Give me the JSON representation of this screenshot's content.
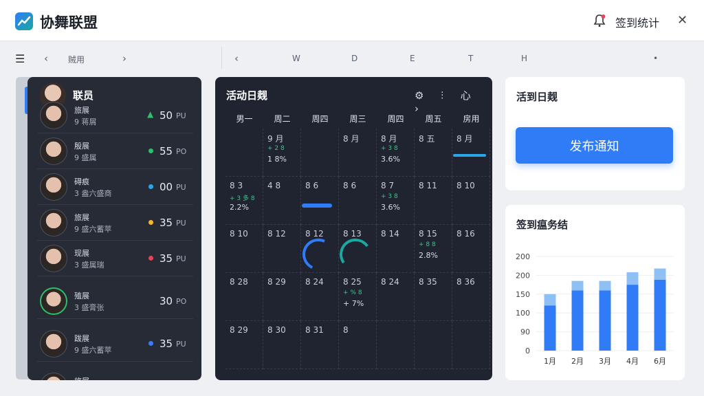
{
  "app": {
    "title": "协舞联盟",
    "stat_link": "签到统计"
  },
  "subbar": {
    "left_label": "贼用",
    "week_letters": [
      "W",
      "D",
      "E",
      "T",
      "H",
      "•"
    ]
  },
  "members": {
    "title": "联员",
    "rows": [
      {
        "name": "旅展",
        "sub": "9 蒋屑",
        "value": "50",
        "unit": "PU",
        "color": "#2fbf6a",
        "indicator": "arrow-up"
      },
      {
        "name": "殷展",
        "sub": "9 盛属",
        "value": "55",
        "unit": "PO",
        "color": "#2fbf6a",
        "indicator": "dot"
      },
      {
        "name": "碍痕",
        "sub": "3 盎六盛商",
        "value": "00",
        "unit": "PU",
        "color": "#2aa7e6",
        "indicator": "dot"
      },
      {
        "name": "旅展",
        "sub": "9 盛六蓄苹",
        "value": "35",
        "unit": "PU",
        "color": "#f2b632",
        "indicator": "dot"
      },
      {
        "name": "现展",
        "sub": "3 盛属瑞",
        "value": "35",
        "unit": "PU",
        "color": "#e5445a",
        "indicator": "dot"
      },
      {
        "name": "殖展",
        "sub": "3 盛膏张",
        "value": "30",
        "unit": "PO",
        "color": "#2fbf6a",
        "indicator": "ring"
      },
      {
        "name": "跋展",
        "sub": "9 盛六蓄苹",
        "value": "35",
        "unit": "PU",
        "color": "#3e7bf0",
        "indicator": "dot"
      },
      {
        "name": "旅展",
        "sub": "",
        "value": "",
        "unit": "",
        "color": "#2fbf6a",
        "indicator": "none"
      }
    ]
  },
  "calendar": {
    "title": "活动日觌",
    "icons": [
      "gear-icon",
      "tune-icon",
      "heart-icon",
      "chevron-right-icon"
    ],
    "icon_glyphs": "⚙ ⫶ 心 ›",
    "weekdays": [
      "男一",
      "周二",
      "周四",
      "周三",
      "周四",
      "周五",
      "房用"
    ],
    "rows": [
      [
        {
          "d": "",
          "e1": "",
          "e2": ""
        },
        {
          "d": "9 月",
          "e1": "+ 2 8 ",
          "e2": "1 8%"
        },
        {
          "d": "",
          "e1": "",
          "e2": ""
        },
        {
          "d": "8 月",
          "e1": "",
          "e2": ""
        },
        {
          "d": "8 月",
          "e1": "+ 3 8 ",
          "e2": "3.6%"
        },
        {
          "d": "8 五",
          "e1": "",
          "e2": ""
        },
        {
          "d": "8 月",
          "e1": "",
          "e2": ""
        }
      ],
      [
        {
          "d": "8 3",
          "e1": "+ 3 多 8",
          "e2": "2.2%"
        },
        {
          "d": "4 8",
          "e1": "",
          "e2": ""
        },
        {
          "d": "8 6",
          "e1": "",
          "e2": ""
        },
        {
          "d": "8 6",
          "e1": "",
          "e2": ""
        },
        {
          "d": "8 7",
          "e1": "+ 3 8 ",
          "e2": "3.6%"
        },
        {
          "d": "8 11",
          "e1": "",
          "e2": ""
        },
        {
          "d": "8 10",
          "e1": "",
          "e2": ""
        }
      ],
      [
        {
          "d": "8 10",
          "e1": "",
          "e2": ""
        },
        {
          "d": "8 12",
          "e1": "",
          "e2": ""
        },
        {
          "d": "8 12",
          "e1": "",
          "e2": ""
        },
        {
          "d": "8 13",
          "e1": "",
          "e2": ""
        },
        {
          "d": "8 14",
          "e1": "",
          "e2": ""
        },
        {
          "d": "8 15",
          "e1": "+ 8 8 ",
          "e2": "2.8%"
        },
        {
          "d": "8 16",
          "e1": "",
          "e2": ""
        }
      ],
      [
        {
          "d": "8 28",
          "e1": "",
          "e2": ""
        },
        {
          "d": "8 29",
          "e1": "",
          "e2": ""
        },
        {
          "d": "8 24",
          "e1": "",
          "e2": ""
        },
        {
          "d": "8 25",
          "e1": "+ % 8 ",
          "e2": "+ 7%"
        },
        {
          "d": "8 24",
          "e1": "",
          "e2": ""
        },
        {
          "d": "8 35",
          "e1": "",
          "e2": ""
        },
        {
          "d": "8 36",
          "e1": "",
          "e2": ""
        }
      ],
      [
        {
          "d": "8 29",
          "e1": "",
          "e2": ""
        },
        {
          "d": "8 30",
          "e1": "",
          "e2": ""
        },
        {
          "d": "8 31",
          "e1": "",
          "e2": ""
        },
        {
          "d": "8 ",
          "e1": "",
          "e2": ""
        },
        {
          "d": "",
          "e1": "",
          "e2": ""
        },
        {
          "d": "",
          "e1": "",
          "e2": ""
        },
        {
          "d": "",
          "e1": "",
          "e2": ""
        }
      ]
    ]
  },
  "right_top": {
    "title": "活到日觌",
    "button": "发布通知"
  },
  "right_chart": {
    "title": "签到瘟务结",
    "chart_data": {
      "type": "bar",
      "categories": [
        "1月",
        "2月",
        "3月",
        "4月",
        "6月"
      ],
      "y_tick_labels": [
        "200",
        "200",
        "150",
        "100",
        "90",
        "0"
      ],
      "series": [
        {
          "values": [
            120,
            160,
            160,
            175,
            188
          ],
          "color": "#2f7cf6"
        },
        {
          "values": [
            30,
            25,
            25,
            33,
            30
          ],
          "color": "#8fc0f3"
        }
      ],
      "ylim": [
        0,
        250
      ],
      "grid": true
    }
  }
}
